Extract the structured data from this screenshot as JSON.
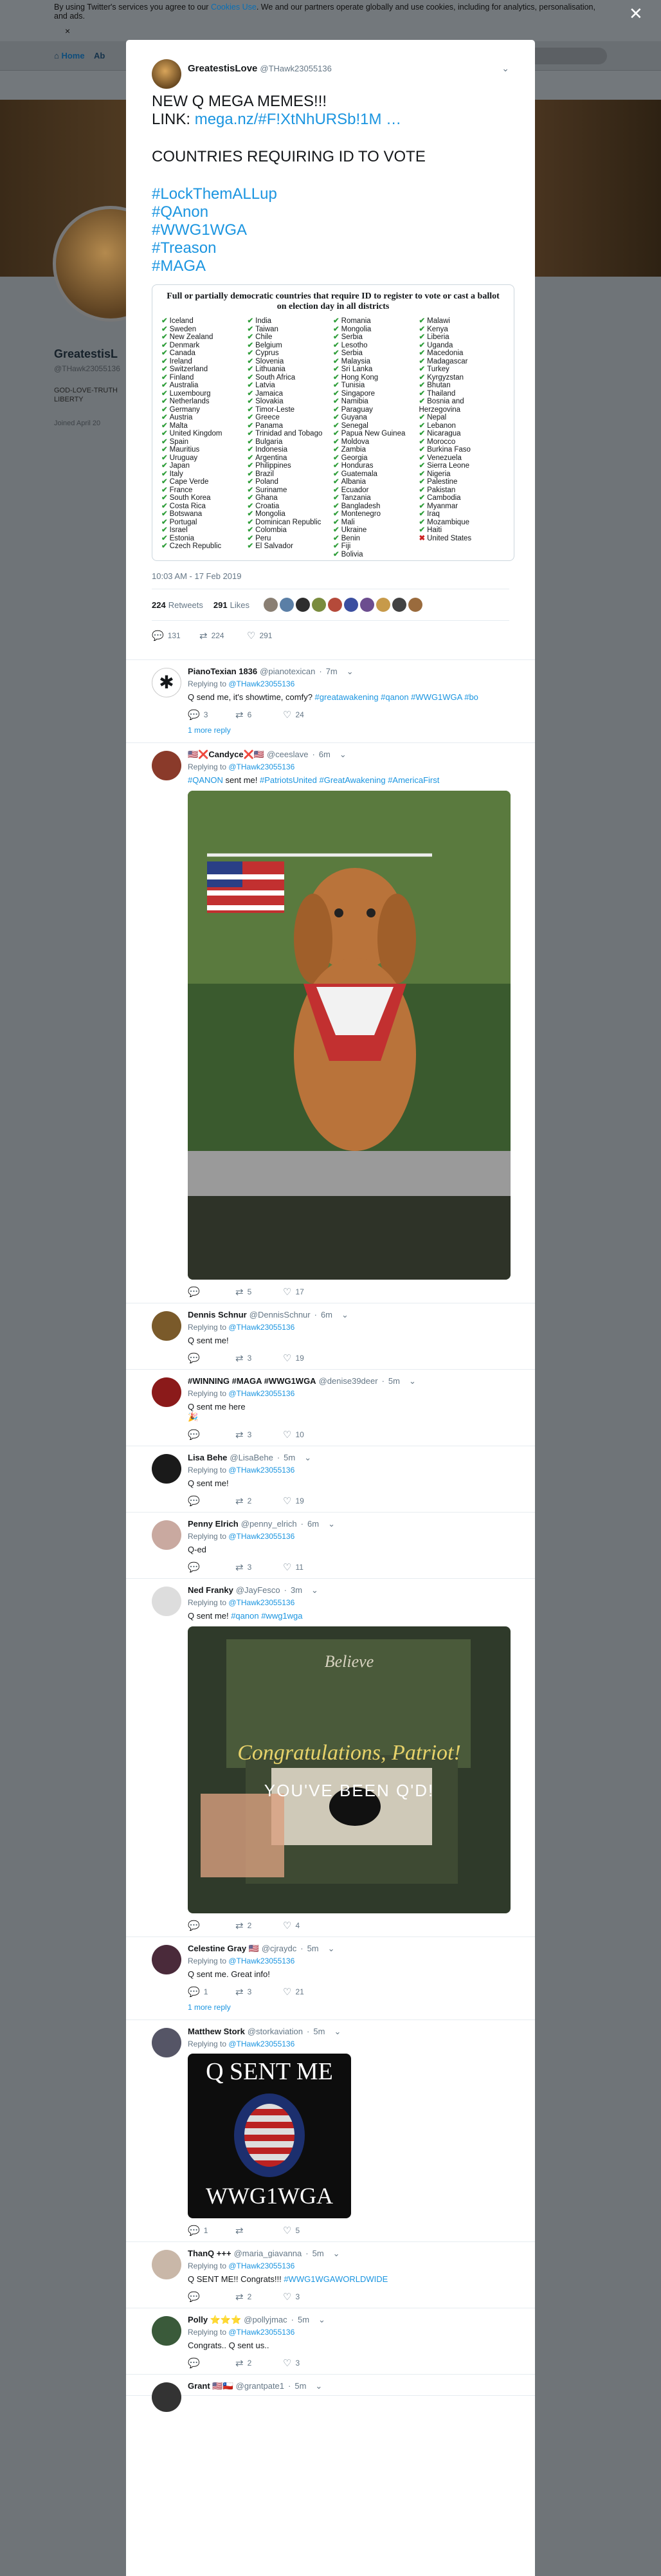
{
  "cookie_bar": {
    "text_before": "By using Twitter's services you agree to our ",
    "link": "Cookies Use",
    "text_after": ". We and our partners operate globally and use cookies, including for analytics, personalisation, and ads.",
    "close": "×"
  },
  "nav": {
    "home": "Home",
    "about": "Ab"
  },
  "profile_background": {
    "name": "GreatestisL",
    "handle": "@THawk23055136",
    "bio": "GOD-LOVE-TRUTH LIBERTY",
    "joined": "Joined April 20"
  },
  "overlay_close": "✕",
  "tweet": {
    "author_name": "GreatestisLove",
    "author_handle": "@THawk23055136",
    "lines": [
      {
        "text": "NEW Q MEGA MEMES!!!",
        "link": false
      },
      {
        "text": "LINK: ",
        "link": false,
        "link_text": "mega.nz/#F!XtNhURSb!1M …"
      },
      {
        "text": "",
        "gap": true
      },
      {
        "text": "COUNTRIES REQUIRING ID TO VOTE",
        "link": false
      },
      {
        "text": "",
        "gap": true
      },
      {
        "text": "#LockThemALLup",
        "link": true
      },
      {
        "text": "#QAnon",
        "link": true
      },
      {
        "text": "#WWG1WGA",
        "link": true
      },
      {
        "text": "#Treason",
        "link": true
      },
      {
        "text": "#MAGA",
        "link": true
      }
    ],
    "card_title": "Full or partially democratic countries that require ID to register to vote or cast a ballot on election day in all districts",
    "countries": [
      [
        "Iceland",
        "Sweden",
        "New Zealand",
        "Denmark",
        "Canada",
        "Ireland",
        "Switzerland",
        "Finland",
        "Australia",
        "Luxembourg",
        "Netherlands",
        "Germany",
        "Austria",
        "Malta",
        "United Kingdom",
        "Spain",
        "Mauritius",
        "Uruguay",
        "Japan",
        "Italy",
        "Cape Verde",
        "France",
        "South Korea",
        "Costa Rica",
        "Botswana",
        "Portugal",
        "Israel",
        "Estonia",
        "Czech Republic"
      ],
      [
        "India",
        "Taiwan",
        "Chile",
        "Belgium",
        "Cyprus",
        "Slovenia",
        "Lithuania",
        "South Africa",
        "Latvia",
        "Jamaica",
        "Slovakia",
        "Timor-Leste",
        "Greece",
        "Panama",
        "Trinidad and Tobago",
        "Bulgaria",
        "Indonesia",
        "Argentina",
        "Philippines",
        "Brazil",
        "Poland",
        "Suriname",
        "Ghana",
        "Croatia",
        "Mongolia",
        "Dominican Republic",
        "Colombia",
        "Peru",
        "El Salvador"
      ],
      [
        "Romania",
        "Mongolia",
        "Serbia",
        "Lesotho",
        "Serbia",
        "Malaysia",
        "Sri Lanka",
        "Hong Kong",
        "Tunisia",
        "Singapore",
        "Namibia",
        "Paraguay",
        "Guyana",
        "Senegal",
        "Papua New Guinea",
        "Moldova",
        "Zambia",
        "Georgia",
        "Honduras",
        "Guatemala",
        "Albania",
        "Ecuador",
        "Tanzania",
        "Bangladesh",
        "Montenegro",
        "Mali",
        "Ukraine",
        "Benin",
        "Fiji",
        "Bolivia"
      ],
      [
        "Malawi",
        "Kenya",
        "Liberia",
        "Uganda",
        "Macedonia",
        "Madagascar",
        "Turkey",
        "Kyrgyzstan",
        "Bhutan",
        "Thailand",
        "Bosnia and Herzegovina",
        "Nepal",
        "Lebanon",
        "Nicaragua",
        "Morocco",
        "Burkina Faso",
        "Venezuela",
        "Sierra Leone",
        "Nigeria",
        "Palestine",
        "Pakistan",
        "Cambodia",
        "Myanmar",
        "Iraq",
        "Mozambique",
        "Haiti",
        "United States"
      ]
    ],
    "card_not_checked": "United States",
    "timestamp": "10:03 AM - 17 Feb 2019",
    "retweets_count": "224",
    "retweets_label": "Retweets",
    "likes_count": "291",
    "likes_label": "Likes",
    "liker_colors": [
      "#8a7f73",
      "#5b7fa6",
      "#2d2d2d",
      "#7a8c3e",
      "#b54a3a",
      "#3b4fa0",
      "#6c4d8f",
      "#c79a4a",
      "#424242",
      "#9a6b3d"
    ],
    "reply_count": "131",
    "retweet_count": "224",
    "like_count": "291"
  },
  "replies": [
    {
      "name": "PianoTexian 1836",
      "handle": "@pianotexican",
      "time": "7m",
      "to": "@THawk23055136",
      "text": "Q send me, it's showtime, comfy? ",
      "tags": "#greatawakening #qanon #WWG1WGA #bo",
      "reply": "3",
      "rt": "6",
      "like": "24",
      "more": "1 more reply",
      "avatar_color": "#ffffff"
    },
    {
      "name": "🇺🇸❌Candyce❌🇺🇸",
      "handle": "@ceeslave",
      "time": "6m",
      "to": "@THawk23055136",
      "text": "",
      "tags": "#QANON sent me! #PatriotsUnited #GreatAwakening #AmericaFirst",
      "mixed": [
        "#QANON",
        " sent me! ",
        "#PatriotsUnited #GreatAwakening #AmericaFirst"
      ],
      "reply": "",
      "rt": "5",
      "like": "17",
      "avatar_color": "#8a3a2a"
    },
    {
      "name": "Dennis Schnur",
      "handle": "@DennisSchnur",
      "time": "6m",
      "to": "@THawk23055136",
      "text": "Q sent me!",
      "reply": "",
      "rt": "3",
      "like": "19",
      "avatar_color": "#7a5a2a"
    },
    {
      "name": "#WINNING #MAGA #WWG1WGA",
      "handle": "@denise39deer",
      "time": "5m",
      "to": "@THawk23055136",
      "text": "Q sent me here",
      "emoji": "🎉",
      "reply": "",
      "rt": "3",
      "like": "10",
      "avatar_color": "#8b1a1a"
    },
    {
      "name": "Lisa Behe",
      "handle": "@LisaBehe",
      "time": "5m",
      "to": "@THawk23055136",
      "text": "Q sent me!",
      "reply": "",
      "rt": "2",
      "like": "19",
      "avatar_color": "#1a1a1a"
    },
    {
      "name": "Penny Elrich",
      "handle": "@penny_elrich",
      "time": "6m",
      "to": "@THawk23055136",
      "text": "Q-ed",
      "reply": "",
      "rt": "3",
      "like": "11",
      "avatar_color": "#c9a9a0"
    },
    {
      "name": "Ned Franky",
      "handle": "@JayFesco",
      "time": "3m",
      "to": "@THawk23055136",
      "text": "Q sent me! ",
      "tags": "#qanon #wwg1wga",
      "reply": "",
      "rt": "2",
      "like": "4",
      "avatar_color": "#dddddd",
      "media_caption_1": "Congratulations, Patriot!",
      "media_caption_2": "YOU'VE BEEN Q'D!",
      "media_brand": "Believe"
    },
    {
      "name": "Celestine Gray 🇺🇸",
      "handle": "@cjraydc",
      "time": "5m",
      "to": "@THawk23055136",
      "text": "Q sent me. Great info!",
      "reply": "1",
      "rt": "3",
      "like": "21",
      "more": "1 more reply",
      "avatar_color": "#4a2a3a"
    },
    {
      "name": "Matthew Stork",
      "handle": "@storkaviation",
      "time": "5m",
      "to": "@THawk23055136",
      "text": "",
      "reply": "1",
      "rt": "",
      "like": "5",
      "avatar_color": "#556",
      "media_top": "Q SENT ME",
      "media_bottom": "WWG1WGA"
    },
    {
      "name": "ThanQ +++",
      "handle": "@maria_giavanna",
      "time": "5m",
      "to": "@THawk23055136",
      "text": "Q SENT ME!! Congrats!!! ",
      "tags": "#WWG1WGAWORLDWIDE",
      "reply": "",
      "rt": "2",
      "like": "3",
      "avatar_color": "#c9b7a8"
    },
    {
      "name": "Polly ⭐⭐⭐",
      "handle": "@pollyjmac",
      "time": "5m",
      "to": "@THawk23055136",
      "text": "Congrats.. Q sent us..",
      "reply": "",
      "rt": "2",
      "like": "3",
      "avatar_color": "#3a5a3a"
    },
    {
      "name": "Grant 🇺🇸🇨🇱",
      "handle": "@grantpate1",
      "time": "5m",
      "to": "",
      "text": "",
      "reply": "",
      "rt": "",
      "like": "",
      "avatar_color": "#333"
    }
  ]
}
